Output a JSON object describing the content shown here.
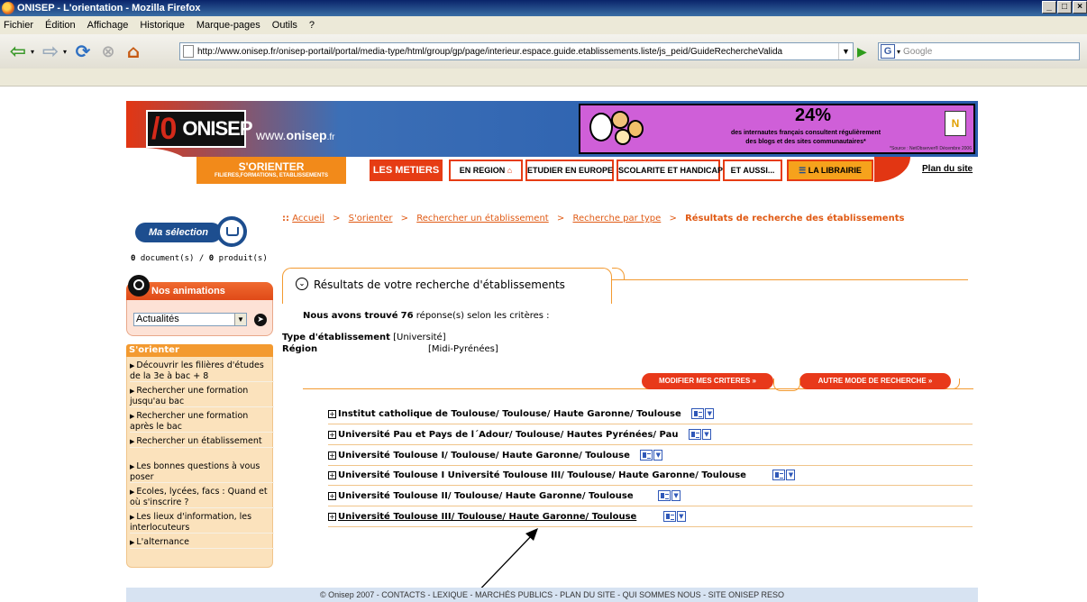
{
  "window": {
    "title": "ONISEP - L'orientation - Mozilla Firefox",
    "controls": [
      "_",
      "□",
      "×"
    ]
  },
  "menu": [
    "Fichier",
    "Édition",
    "Affichage",
    "Historique",
    "Marque-pages",
    "Outils",
    "?"
  ],
  "toolbar": {
    "url": "http://www.onisep.fr/onisep-portail/portal/media-type/html/group/gp/page/interieur.espace.guide.etablissements.liste/js_peid/GuideRechercheValida",
    "search_placeholder": "Google"
  },
  "header": {
    "logo_text": "ONISEP",
    "site_url_prefix": "www.",
    "site_url_name": "onisep",
    "site_url_suffix": ".fr",
    "banner_percent": "24%",
    "banner_line1": "des internautes français consultent régulièrement",
    "banner_line2": "des blogs et des sites communautaires*",
    "banner_fine": "*Source : NetObserver® Décembre 2006",
    "tabs": {
      "orienter": "S'ORIENTER",
      "orienter_sub": "FILIERES,FORMATIONS, ETABLISSEMENTS",
      "metiers": "LES METIERS",
      "region": "EN REGION",
      "europe": "ETUDIER EN EUROPE",
      "handicap": "SCOLARITE ET HANDICAP",
      "aussi": "ET AUSSI...",
      "librairie": "LA LIBRAIRIE",
      "plan": "Plan du site"
    }
  },
  "left": {
    "selection_label": "Ma sélection",
    "doc_count": "0",
    "doc_label": "document(s) /",
    "prod_count": "0",
    "prod_label": "produit(s)",
    "anim_title": "Nos animations",
    "anim_selected": "Actualités",
    "orienter_title": "S'orienter",
    "orienter_items": [
      "Découvrir les filières d'études de la 3e à bac + 8",
      "Rechercher une formation jusqu'au bac",
      "Rechercher une formation après le bac",
      "Rechercher un établissement",
      "Les bonnes questions à vous poser",
      "Ecoles, lycées, facs : Quand et où s'inscrire ?",
      "Les lieux d'information, les interlocuteurs",
      "L'alternance"
    ]
  },
  "breadcrumb": {
    "items": [
      "Accueil",
      "S'orienter",
      "Rechercher un établissement",
      "Recherche par type"
    ],
    "current": "Résultats de recherche des établissements",
    "separator": ">"
  },
  "results": {
    "title": "Résultats de votre recherche d'établissements",
    "found_prefix": "Nous avons trouvé",
    "found_count": "76",
    "found_suffix": "réponse(s) selon les critères :",
    "type_label": "Type d'établissement",
    "type_value": "[Université]",
    "region_label": "Région",
    "region_value": "[Midi-Pyrénées]",
    "btn_modify": "MODIFIER MES CRITERES »",
    "btn_other": "AUTRE MODE DE RECHERCHE »",
    "rows": [
      "Institut catholique de Toulouse/  Toulouse/  Haute Garonne/  Toulouse",
      "Université Pau et Pays de l´Adour/  Toulouse/  Hautes Pyrénées/  Pau",
      "Université Toulouse I/  Toulouse/  Haute Garonne/  Toulouse",
      "Université Toulouse I Université Toulouse III/  Toulouse/  Haute Garonne/  Toulouse",
      "Université Toulouse II/  Toulouse/  Haute Garonne/  Toulouse",
      "Université Toulouse III/  Toulouse/  Haute Garonne/  Toulouse"
    ]
  },
  "footer": "© Onisep 2007 - CONTACTS - LEXIQUE - MARCHÉS PUBLICS - PLAN DU SITE - QUI SOMMES NOUS - SITE ONISEP RESO"
}
